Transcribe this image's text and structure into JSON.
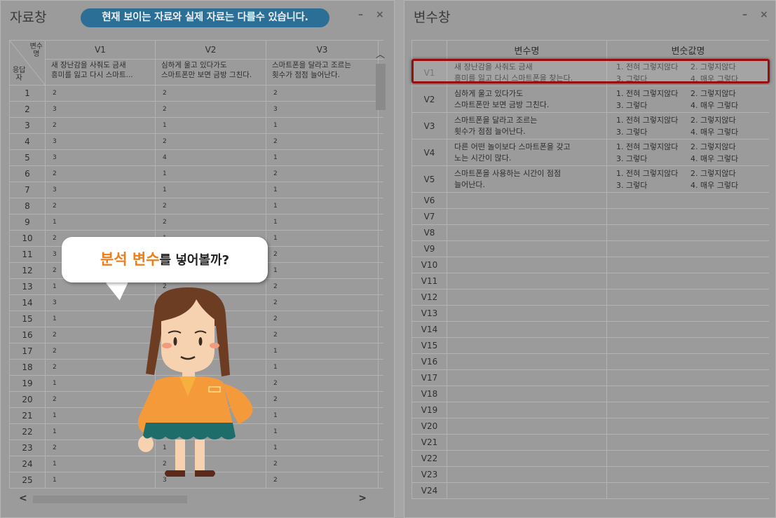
{
  "data_panel": {
    "title": "자료창",
    "notice": "현재 보이는 자료와 실제 자료는 다를수 있습니다.",
    "minimize": "–",
    "close": "×",
    "corner_top": "변수\n명",
    "corner_bottom": "응답\n자",
    "columns": [
      {
        "id": "V1",
        "label": "새 장난감을 사줘도 금새\n흥미를 잃고 다시 스마트..."
      },
      {
        "id": "V2",
        "label": "심하게 울고 있다가도\n스마트폰만 보면 금방 그친다."
      },
      {
        "id": "V3",
        "label": "스마트폰을 달라고 조르는\n횟수가 점점 늘어난다."
      }
    ],
    "rows": [
      {
        "id": "1",
        "v": [
          "2",
          "2",
          "2"
        ]
      },
      {
        "id": "2",
        "v": [
          "3",
          "2",
          "3"
        ]
      },
      {
        "id": "3",
        "v": [
          "2",
          "1",
          "1"
        ]
      },
      {
        "id": "4",
        "v": [
          "3",
          "2",
          "2"
        ]
      },
      {
        "id": "5",
        "v": [
          "3",
          "4",
          "1"
        ]
      },
      {
        "id": "6",
        "v": [
          "2",
          "1",
          "2"
        ]
      },
      {
        "id": "7",
        "v": [
          "3",
          "1",
          "1"
        ]
      },
      {
        "id": "8",
        "v": [
          "2",
          "2",
          "1"
        ]
      },
      {
        "id": "9",
        "v": [
          "1",
          "2",
          "1"
        ]
      },
      {
        "id": "10",
        "v": [
          "2",
          "1",
          "1"
        ]
      },
      {
        "id": "11",
        "v": [
          "3",
          "",
          "2"
        ]
      },
      {
        "id": "12",
        "v": [
          "2",
          "",
          "1"
        ]
      },
      {
        "id": "13",
        "v": [
          "1",
          "2",
          "2"
        ]
      },
      {
        "id": "14",
        "v": [
          "3",
          "",
          "2"
        ]
      },
      {
        "id": "15",
        "v": [
          "1",
          "",
          "2"
        ]
      },
      {
        "id": "16",
        "v": [
          "2",
          "",
          "2"
        ]
      },
      {
        "id": "17",
        "v": [
          "2",
          "",
          "1"
        ]
      },
      {
        "id": "18",
        "v": [
          "2",
          "",
          "1"
        ]
      },
      {
        "id": "19",
        "v": [
          "1",
          "",
          "2"
        ]
      },
      {
        "id": "20",
        "v": [
          "2",
          "",
          "2"
        ]
      },
      {
        "id": "21",
        "v": [
          "1",
          "",
          "1"
        ]
      },
      {
        "id": "22",
        "v": [
          "1",
          "",
          "1"
        ]
      },
      {
        "id": "23",
        "v": [
          "2",
          "1",
          "1"
        ]
      },
      {
        "id": "24",
        "v": [
          "1",
          "2",
          "2"
        ]
      },
      {
        "id": "25",
        "v": [
          "1",
          "3",
          "2"
        ]
      },
      {
        "id": "",
        "v": [
          "",
          "",
          ""
        ]
      }
    ]
  },
  "var_panel": {
    "title": "변수창",
    "minimize": "–",
    "close": "×",
    "col_name": "변수명",
    "col_values": "변숫값명",
    "variables": [
      {
        "id": "V1",
        "name": "새 장난감을 사줘도 금새\n흥미를 잃고 다시 스마트폰을 찾는다.",
        "opts": [
          "1. 전혀 그렇지않다",
          "2. 그렇지않다",
          "3. 그렇다",
          "4. 매우 그렇다"
        ]
      },
      {
        "id": "V2",
        "name": "심하게 울고 있다가도\n스마트폰만 보면 금방 그친다.",
        "opts": [
          "1. 전혀 그렇지않다",
          "2. 그렇지않다",
          "3. 그렇다",
          "4. 매우 그렇다"
        ]
      },
      {
        "id": "V3",
        "name": "스마트폰을 달라고 조르는\n횟수가 점점 늘어난다.",
        "opts": [
          "1. 전혀 그렇지않다",
          "2. 그렇지않다",
          "3. 그렇다",
          "4. 매우 그렇다"
        ]
      },
      {
        "id": "V4",
        "name": "다른 어떤 놀이보다 스마트폰을 갖고\n노는 시간이 많다.",
        "opts": [
          "1. 전혀 그렇지않다",
          "2. 그렇지않다",
          "3. 그렇다",
          "4. 매우 그렇다"
        ]
      },
      {
        "id": "V5",
        "name": "스마트폰을 사용하는 시간이 점점\n늘어난다.",
        "opts": [
          "1. 전혀 그렇지않다",
          "2. 그렇지않다",
          "3. 그렇다",
          "4. 매우 그렇다"
        ]
      }
    ],
    "empty_ids": [
      "V6",
      "V7",
      "V8",
      "V9",
      "V10",
      "V11",
      "V12",
      "V13",
      "V14",
      "V15",
      "V16",
      "V17",
      "V18",
      "V19",
      "V20",
      "V21",
      "V22",
      "V23",
      "V24"
    ]
  },
  "bubble": {
    "highlight": "분석 변수",
    "rest": "를 넣어볼까?"
  },
  "colors": {
    "notice_bg": "#2c6f96",
    "highlight_border": "#9b0c0c",
    "accent_orange": "#ef7e1a"
  }
}
